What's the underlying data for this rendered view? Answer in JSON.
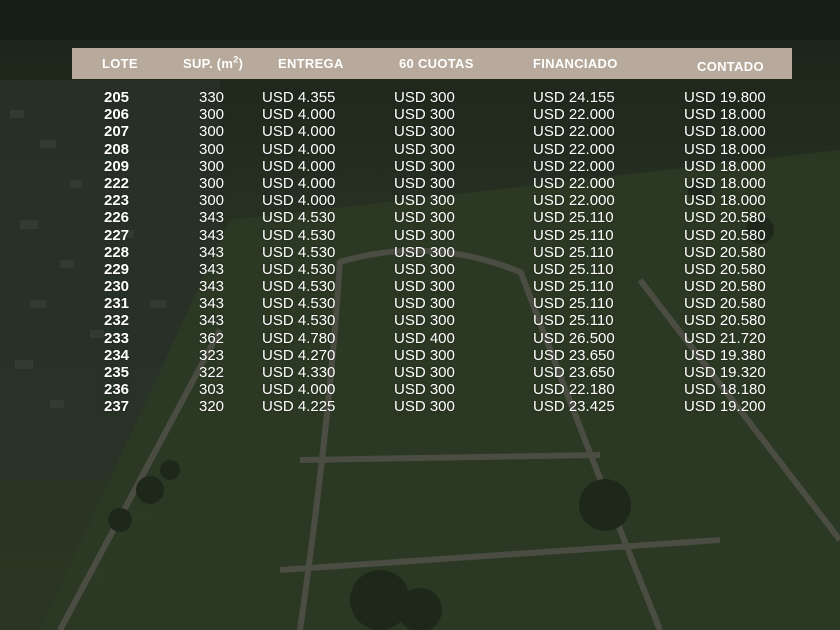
{
  "header": {
    "lote": "LOTE",
    "superficie": "SUP. (m",
    "superficie_exp": "2",
    "superficie_close": ")",
    "entrega": "ENTREGA",
    "cuotas": "60 CUOTAS",
    "financiado": "FINANCIADO",
    "contado": "CONTADO"
  },
  "rows": [
    {
      "lote": "205",
      "sup": "330",
      "entrega": "USD 4.355",
      "cuotas": "USD 300",
      "financiado": "USD 24.155",
      "contado": "USD 19.800"
    },
    {
      "lote": "206",
      "sup": "300",
      "entrega": "USD 4.000",
      "cuotas": "USD 300",
      "financiado": "USD 22.000",
      "contado": "USD 18.000"
    },
    {
      "lote": "207",
      "sup": "300",
      "entrega": "USD 4.000",
      "cuotas": "USD 300",
      "financiado": "USD 22.000",
      "contado": "USD 18.000"
    },
    {
      "lote": "208",
      "sup": "300",
      "entrega": "USD 4.000",
      "cuotas": "USD 300",
      "financiado": "USD 22.000",
      "contado": "USD 18.000"
    },
    {
      "lote": "209",
      "sup": "300",
      "entrega": "USD 4.000",
      "cuotas": "USD 300",
      "financiado": "USD 22.000",
      "contado": "USD 18.000"
    },
    {
      "lote": "222",
      "sup": "300",
      "entrega": "USD 4.000",
      "cuotas": "USD 300",
      "financiado": "USD 22.000",
      "contado": "USD 18.000"
    },
    {
      "lote": "223",
      "sup": "300",
      "entrega": "USD 4.000",
      "cuotas": "USD 300",
      "financiado": "USD 22.000",
      "contado": "USD 18.000"
    },
    {
      "lote": "226",
      "sup": "343",
      "entrega": "USD 4.530",
      "cuotas": "USD 300",
      "financiado": "USD 25.110",
      "contado": "USD 20.580"
    },
    {
      "lote": "227",
      "sup": "343",
      "entrega": "USD 4.530",
      "cuotas": "USD 300",
      "financiado": "USD 25.110",
      "contado": "USD 20.580"
    },
    {
      "lote": "228",
      "sup": "343",
      "entrega": "USD 4.530",
      "cuotas": "USD 300",
      "financiado": "USD 25.110",
      "contado": "USD 20.580"
    },
    {
      "lote": "229",
      "sup": "343",
      "entrega": "USD 4.530",
      "cuotas": "USD 300",
      "financiado": "USD 25.110",
      "contado": "USD 20.580"
    },
    {
      "lote": "230",
      "sup": "343",
      "entrega": "USD 4.530",
      "cuotas": "USD 300",
      "financiado": "USD 25.110",
      "contado": "USD 20.580"
    },
    {
      "lote": "231",
      "sup": "343",
      "entrega": "USD 4.530",
      "cuotas": "USD 300",
      "financiado": "USD 25.110",
      "contado": "USD 20.580"
    },
    {
      "lote": "232",
      "sup": "343",
      "entrega": "USD 4.530",
      "cuotas": "USD 300",
      "financiado": "USD 25.110",
      "contado": "USD 20.580"
    },
    {
      "lote": "233",
      "sup": "362",
      "entrega": "USD 4.780",
      "cuotas": "USD 400",
      "financiado": "USD 26.500",
      "contado": "USD 21.720"
    },
    {
      "lote": "234",
      "sup": "323",
      "entrega": "USD 4.270",
      "cuotas": "USD 300",
      "financiado": "USD 23.650",
      "contado": "USD 19.380"
    },
    {
      "lote": "235",
      "sup": "322",
      "entrega": "USD 4.330",
      "cuotas": "USD 300",
      "financiado": "USD 23.650",
      "contado": "USD 19.320"
    },
    {
      "lote": "236",
      "sup": "303",
      "entrega": "USD 4.000",
      "cuotas": "USD 300",
      "financiado": "USD 22.180",
      "contado": "USD 18.180"
    },
    {
      "lote": "237",
      "sup": "320",
      "entrega": "USD 4.225",
      "cuotas": "USD 300",
      "financiado": "USD 23.425",
      "contado": "USD 19.200"
    }
  ]
}
